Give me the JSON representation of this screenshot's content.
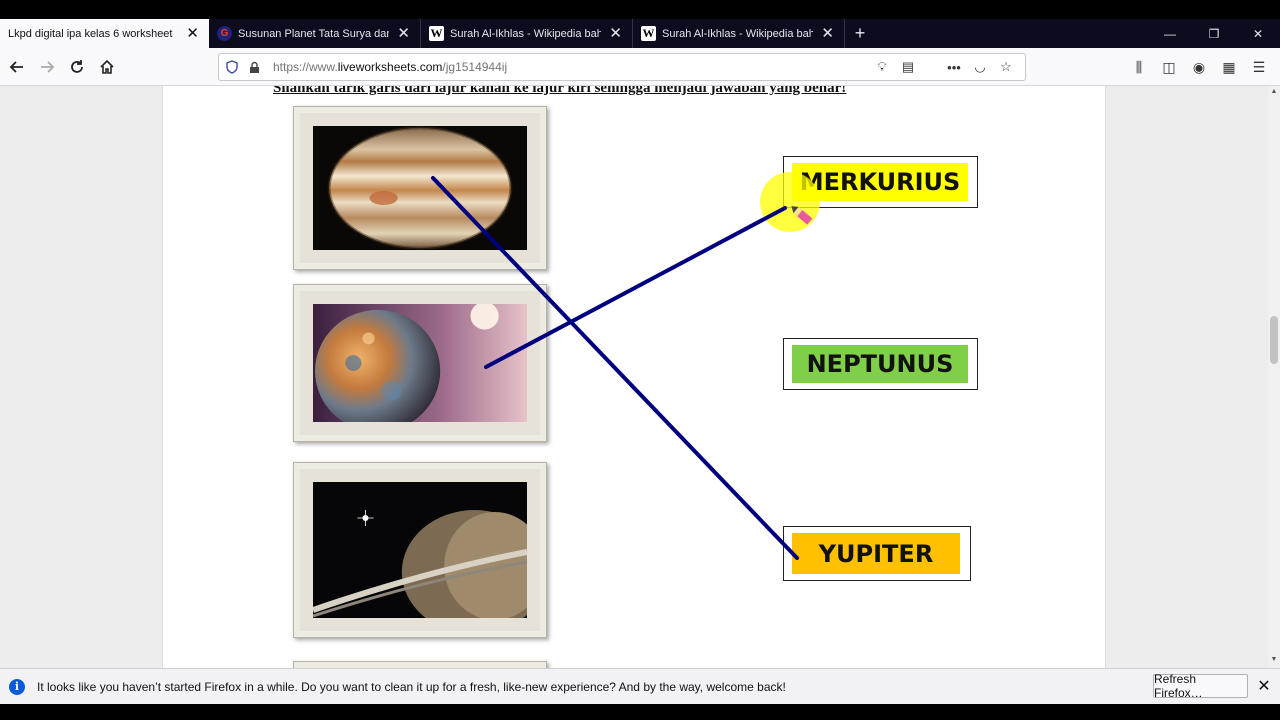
{
  "tabs": [
    {
      "title": "Lkpd digital ipa kelas 6 worksheet",
      "favicon": "liveworksheets-icon",
      "active": true
    },
    {
      "title": "Susunan Planet Tata Surya dan",
      "favicon": "google-icon",
      "active": false
    },
    {
      "title": "Surah Al-Ikhlas - Wikipedia bah",
      "favicon": "wikipedia-icon",
      "active": false
    },
    {
      "title": "Surah Al-Ikhlas - Wikipedia bah",
      "favicon": "wikipedia-icon",
      "active": false
    }
  ],
  "address": {
    "prefix": "https://www.",
    "domain": "liveworksheets.com",
    "path": "/jg1514944ij"
  },
  "worksheet": {
    "instruction": "Silahkan  tarik garis dari lajur kanan ke lajur kiri sehingga menjadi jawaban yang benar!",
    "images": [
      "jupiter-image",
      "mercury-image",
      "saturn-image"
    ],
    "answers": [
      {
        "label": "MERKURIUS",
        "color": "#ffff00"
      },
      {
        "label": "NEPTUNUS",
        "color": "#7fd048"
      },
      {
        "label": "YUPITER",
        "color": "#ffc000"
      }
    ],
    "line_color": "#00007f"
  },
  "notification": {
    "message": "It looks like you haven’t started Firefox in a while. Do you want to clean it up for a fresh, like-new experience? And by the way, welcome back!",
    "button_label": "Refresh Firefox…"
  }
}
